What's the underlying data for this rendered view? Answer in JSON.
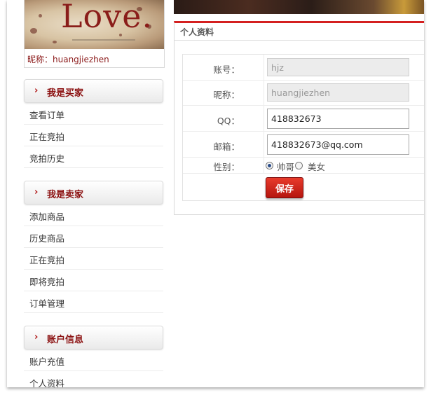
{
  "user": {
    "avatar_text": "Love.",
    "nickname_label": "昵称：",
    "nickname_value": "huangjiezhen"
  },
  "sidebar": {
    "buyer": {
      "title": "我是买家",
      "items": [
        "查看订单",
        "正在竞拍",
        "竞拍历史"
      ]
    },
    "seller": {
      "title": "我是卖家",
      "items": [
        "添加商品",
        "历史商品",
        "正在竞拍",
        "即将竞拍",
        "订单管理"
      ]
    },
    "account": {
      "title": "账户信息",
      "items": [
        "账户充值",
        "个人资料"
      ]
    }
  },
  "panel": {
    "title": "个人资料",
    "fields": {
      "account": {
        "label": "账号：",
        "value": "hjz"
      },
      "nickname": {
        "label": "昵称：",
        "value": "huangjiezhen"
      },
      "qq": {
        "label": "QQ：",
        "value": "418832673"
      },
      "email": {
        "label": "邮箱：",
        "value": "418832673@qq.com"
      },
      "gender": {
        "label": "性别：",
        "options": [
          "帅哥",
          "美女"
        ],
        "selected": "帅哥"
      }
    },
    "save_label": "保存"
  },
  "colors": {
    "accent_red": "#d42020",
    "section_title": "#8b1010",
    "nickname": "#8b1a1a"
  }
}
